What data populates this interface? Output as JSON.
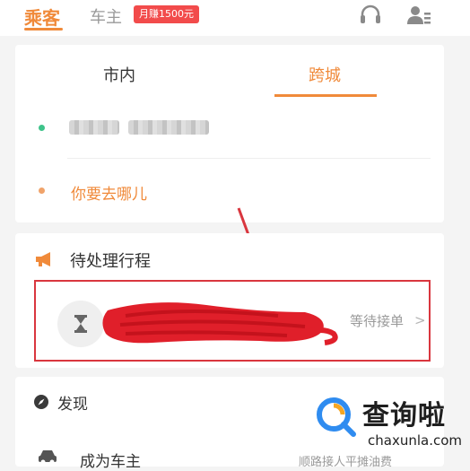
{
  "header": {
    "tab_passenger": "乘客",
    "tab_driver": "车主",
    "promo_badge": "月赚1500元"
  },
  "trip_type": {
    "city": "市内",
    "intercity": "跨城"
  },
  "route": {
    "destination_placeholder": "你要去哪儿"
  },
  "pending": {
    "title": "待处理行程",
    "status": "等待接单",
    "chevron": ">"
  },
  "discover": {
    "title": "发现",
    "become_driver": "成为车主",
    "become_driver_sub": "顺路接人平摊油费"
  },
  "watermark": {
    "title": "查询啦",
    "url": "chaxunla.com"
  },
  "colors": {
    "accent": "#f08a3a",
    "badge": "#f24b4b",
    "highlight_box": "#d9363e",
    "origin_dot": "#3ec38a"
  }
}
